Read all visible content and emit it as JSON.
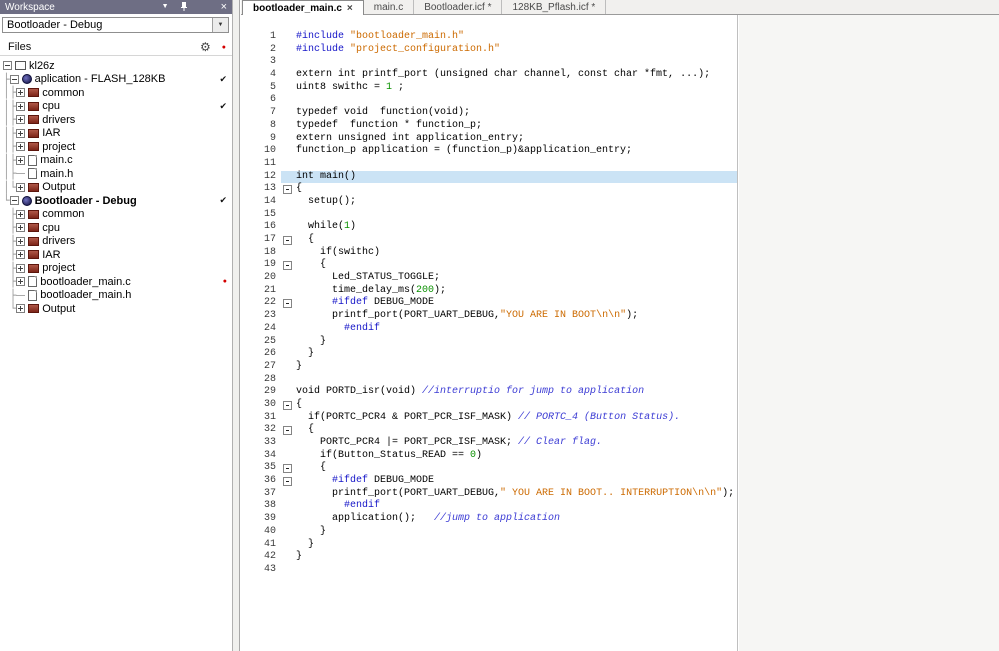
{
  "icons": {
    "dropdown": "▼",
    "combo_arrow": "▼",
    "close": "×",
    "gear": "⚙",
    "check": "✔",
    "dot": "●",
    "tab_close": "×"
  },
  "colors": {
    "preprocessor": "#1616c8",
    "string": "#cc6a00",
    "number": "#0a9000",
    "comment": "#3b3bd4",
    "line_highlight": "#cbe3f5",
    "titlebar": "#6e6e84"
  },
  "workspace": {
    "title": "Workspace",
    "config": "Bootloader - Debug",
    "files_header": "Files",
    "tree": [
      {
        "prefix": "",
        "box": "minus",
        "icon": "workspace",
        "label": "kl26z"
      },
      {
        "prefix": "├",
        "box": "minus",
        "icon": "project",
        "label": "aplication - FLASH_128KB",
        "check": true
      },
      {
        "prefix": "│├",
        "box": "plus",
        "icon": "group",
        "label": "common"
      },
      {
        "prefix": "│├",
        "box": "plus",
        "icon": "group",
        "label": "cpu",
        "check": true
      },
      {
        "prefix": "│├",
        "box": "plus",
        "icon": "group",
        "label": "drivers"
      },
      {
        "prefix": "│├",
        "box": "plus",
        "icon": "group",
        "label": "IAR"
      },
      {
        "prefix": "│├",
        "box": "plus",
        "icon": "group",
        "label": "project"
      },
      {
        "prefix": "│├",
        "box": "plus",
        "icon": "filec",
        "label": "main.c"
      },
      {
        "prefix": "│├",
        "box": "none",
        "icon": "fileh",
        "label": "main.h"
      },
      {
        "prefix": "│└",
        "box": "plus",
        "icon": "group",
        "label": "Output"
      },
      {
        "prefix": "└",
        "box": "minus",
        "icon": "project",
        "label": "Bootloader - Debug",
        "bold": true,
        "check": true
      },
      {
        "prefix": " ├",
        "box": "plus",
        "icon": "group",
        "label": "common"
      },
      {
        "prefix": " ├",
        "box": "plus",
        "icon": "group",
        "label": "cpu"
      },
      {
        "prefix": " ├",
        "box": "plus",
        "icon": "group",
        "label": "drivers"
      },
      {
        "prefix": " ├",
        "box": "plus",
        "icon": "group",
        "label": "IAR"
      },
      {
        "prefix": " ├",
        "box": "plus",
        "icon": "group",
        "label": "project"
      },
      {
        "prefix": " ├",
        "box": "plus",
        "icon": "filec",
        "label": "bootloader_main.c",
        "dot": true
      },
      {
        "prefix": " ├",
        "box": "none",
        "icon": "fileh",
        "label": "bootloader_main.h"
      },
      {
        "prefix": " └",
        "box": "plus",
        "icon": "group",
        "label": "Output"
      }
    ]
  },
  "editor": {
    "tabs": [
      {
        "label": "bootloader_main.c",
        "active": true,
        "close": "×"
      },
      {
        "label": "main.c"
      },
      {
        "label": "Bootloader.icf *"
      },
      {
        "label": "128KB_Pflash.icf *"
      }
    ],
    "code": [
      {
        "n": 1,
        "s": [
          [
            "pp",
            "#include "
          ],
          [
            "str",
            "\"bootloader_main.h\""
          ]
        ]
      },
      {
        "n": 2,
        "s": [
          [
            "pp",
            "#include "
          ],
          [
            "str",
            "\"project_configuration.h\""
          ]
        ]
      },
      {
        "n": 3,
        "s": []
      },
      {
        "n": 4,
        "s": [
          [
            "t",
            "extern int printf_port (unsigned char channel, const char *fmt, ...);"
          ]
        ]
      },
      {
        "n": 5,
        "s": [
          [
            "t",
            "uint8 swithc = "
          ],
          [
            "num",
            "1"
          ],
          [
            "t",
            " ;"
          ]
        ]
      },
      {
        "n": 6,
        "s": []
      },
      {
        "n": 7,
        "s": [
          [
            "t",
            "typedef void  function(void);"
          ]
        ]
      },
      {
        "n": 8,
        "s": [
          [
            "t",
            "typedef  function * function_p;"
          ]
        ]
      },
      {
        "n": 9,
        "s": [
          [
            "t",
            "extern unsigned int application_entry;"
          ]
        ]
      },
      {
        "n": 10,
        "s": [
          [
            "t",
            "function_p application = (function_p)&application_entry;"
          ]
        ]
      },
      {
        "n": 11,
        "s": []
      },
      {
        "n": 12,
        "h": true,
        "s": [
          [
            "t",
            "int main()"
          ]
        ]
      },
      {
        "n": 13,
        "f": true,
        "s": [
          [
            "t",
            "{"
          ]
        ]
      },
      {
        "n": 14,
        "s": [
          [
            "t",
            "  setup();"
          ]
        ]
      },
      {
        "n": 15,
        "s": []
      },
      {
        "n": 16,
        "s": [
          [
            "t",
            "  while("
          ],
          [
            "num",
            "1"
          ],
          [
            "t",
            ")"
          ]
        ]
      },
      {
        "n": 17,
        "f": true,
        "s": [
          [
            "t",
            "  {"
          ]
        ]
      },
      {
        "n": 18,
        "s": [
          [
            "t",
            "    if(swithc)"
          ]
        ]
      },
      {
        "n": 19,
        "f": true,
        "s": [
          [
            "t",
            "    {"
          ]
        ]
      },
      {
        "n": 20,
        "s": [
          [
            "t",
            "      Led_STATUS_TOGGLE;"
          ]
        ]
      },
      {
        "n": 21,
        "s": [
          [
            "t",
            "      time_delay_ms("
          ],
          [
            "num",
            "200"
          ],
          [
            "t",
            ");"
          ]
        ]
      },
      {
        "n": 22,
        "f": true,
        "s": [
          [
            "t",
            "      "
          ],
          [
            "pp",
            "#ifdef"
          ],
          [
            "t",
            " DEBUG_MODE"
          ]
        ]
      },
      {
        "n": 23,
        "s": [
          [
            "t",
            "      printf_port(PORT_UART_DEBUG,"
          ],
          [
            "str",
            "\"YOU ARE IN BOOT\\n\\n\""
          ],
          [
            "t",
            ");"
          ]
        ]
      },
      {
        "n": 24,
        "s": [
          [
            "t",
            "        "
          ],
          [
            "pp",
            "#endif"
          ]
        ]
      },
      {
        "n": 25,
        "s": [
          [
            "t",
            "    }"
          ]
        ]
      },
      {
        "n": 26,
        "s": [
          [
            "t",
            "  }"
          ]
        ]
      },
      {
        "n": 27,
        "s": [
          [
            "t",
            "}"
          ]
        ]
      },
      {
        "n": 28,
        "s": []
      },
      {
        "n": 29,
        "s": [
          [
            "t",
            "void PORTD_isr(void) "
          ],
          [
            "com",
            "//interruptio for jump to application"
          ]
        ]
      },
      {
        "n": 30,
        "f": true,
        "s": [
          [
            "t",
            "{"
          ]
        ]
      },
      {
        "n": 31,
        "s": [
          [
            "t",
            "  if(PORTC_PCR4 & PORT_PCR_ISF_MASK) "
          ],
          [
            "com",
            "// PORTC_4 (Button Status)."
          ]
        ]
      },
      {
        "n": 32,
        "f": true,
        "s": [
          [
            "t",
            "  {"
          ]
        ]
      },
      {
        "n": 33,
        "s": [
          [
            "t",
            "    PORTC_PCR4 |= PORT_PCR_ISF_MASK; "
          ],
          [
            "com",
            "// Clear flag."
          ]
        ]
      },
      {
        "n": 34,
        "s": [
          [
            "t",
            "    if(Button_Status_READ == "
          ],
          [
            "num",
            "0"
          ],
          [
            "t",
            ")"
          ]
        ]
      },
      {
        "n": 35,
        "f": true,
        "s": [
          [
            "t",
            "    {"
          ]
        ]
      },
      {
        "n": 36,
        "f": true,
        "s": [
          [
            "t",
            "      "
          ],
          [
            "pp",
            "#ifdef"
          ],
          [
            "t",
            " DEBUG_MODE"
          ]
        ]
      },
      {
        "n": 37,
        "s": [
          [
            "t",
            "      printf_port(PORT_UART_DEBUG,"
          ],
          [
            "str",
            "\" YOU ARE IN BOOT.. INTERRUPTION\\n\\n\""
          ],
          [
            "t",
            ");"
          ]
        ]
      },
      {
        "n": 38,
        "s": [
          [
            "t",
            "        "
          ],
          [
            "pp",
            "#endif"
          ]
        ]
      },
      {
        "n": 39,
        "s": [
          [
            "t",
            "      application();   "
          ],
          [
            "com",
            "//jump to application"
          ]
        ]
      },
      {
        "n": 40,
        "s": [
          [
            "t",
            "    }"
          ]
        ]
      },
      {
        "n": 41,
        "s": [
          [
            "t",
            "  }"
          ]
        ]
      },
      {
        "n": 42,
        "s": [
          [
            "t",
            "}"
          ]
        ]
      },
      {
        "n": 43,
        "s": []
      }
    ]
  }
}
